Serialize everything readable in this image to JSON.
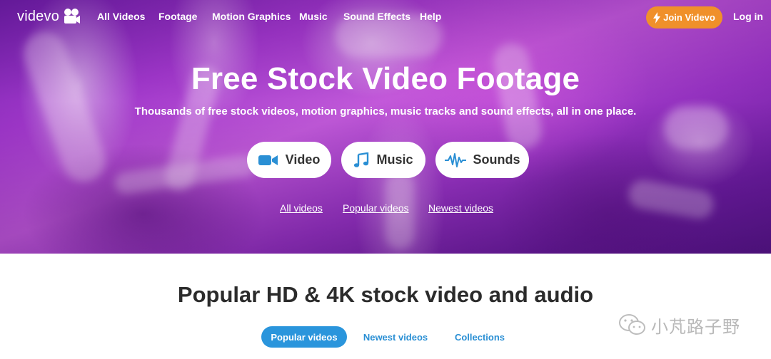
{
  "brand": {
    "name": "videvo"
  },
  "nav": {
    "items": [
      "All Videos",
      "Footage",
      "Motion Graphics",
      "Music",
      "Sound Effects",
      "Help"
    ],
    "join_label": "Join Videvo",
    "login_label": "Log in"
  },
  "hero": {
    "title": "Free Stock Video Footage",
    "subtitle": "Thousands of free stock videos, motion graphics, music tracks and sound effects, all in one place.",
    "buttons": [
      {
        "label": "Video",
        "icon": "video-camera-icon"
      },
      {
        "label": "Music",
        "icon": "music-note-icon"
      },
      {
        "label": "Sounds",
        "icon": "sound-wave-icon"
      }
    ],
    "links": [
      "All videos",
      "Popular videos",
      "Newest videos"
    ]
  },
  "section": {
    "title": "Popular HD & 4K stock video and audio",
    "tabs": [
      "Popular videos",
      "Newest videos",
      "Collections"
    ],
    "active_tab": "Popular videos"
  },
  "watermark": {
    "text": "小芃路子野"
  },
  "colors": {
    "accent_orange": "#f0902a",
    "accent_blue": "#2a95dc",
    "icon_blue": "#2a8fd4",
    "hero_purple": "#a53ad0"
  }
}
